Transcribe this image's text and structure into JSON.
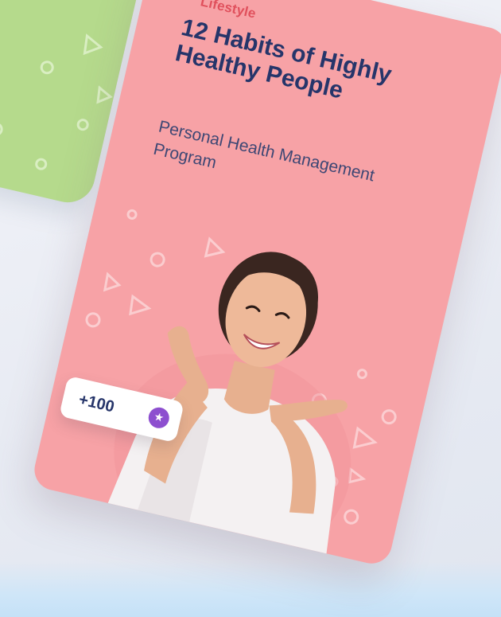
{
  "card": {
    "category": "Lifestyle",
    "title": "12 Habits of Highly Healthy People",
    "subtitle": "Personal Health Management Program"
  },
  "badge": {
    "points": "+100",
    "icon": "star-icon"
  },
  "colors": {
    "card_background": "#f7a2a6",
    "category_text": "#e0505c",
    "title_text": "#26356a",
    "side_card": "#b5da8c",
    "coin": "#8d4fcf"
  }
}
